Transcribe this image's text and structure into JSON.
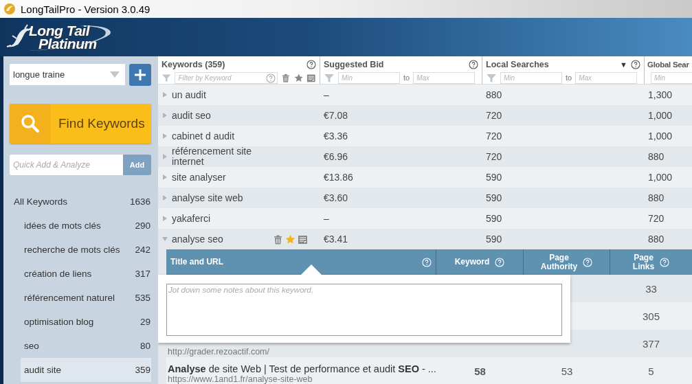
{
  "window": {
    "title": "LongTailPro - Version 3.0.49"
  },
  "logo": {
    "line_1": "Long Tail",
    "line_2": "Platinum"
  },
  "sidebar": {
    "project_select": {
      "value": "longue traine"
    },
    "find_button": "Find Keywords",
    "quick_add": {
      "placeholder": "Quick Add & Analyze",
      "button": "Add"
    },
    "campaigns": [
      {
        "label": "All Keywords",
        "count": "1636",
        "selected": false,
        "children": [
          {
            "label": "idées de mots clés",
            "count": "290",
            "selected": false
          },
          {
            "label": "recherche de mots clés",
            "count": "242",
            "selected": false
          },
          {
            "label": "création de liens",
            "count": "317",
            "selected": false
          },
          {
            "label": "référencement naturel",
            "count": "535",
            "selected": false
          },
          {
            "label": "optimisation blog",
            "count": "29",
            "selected": false
          },
          {
            "label": "seo",
            "count": "80",
            "selected": false
          },
          {
            "label": "audit site",
            "count": "359",
            "selected": true
          }
        ]
      }
    ]
  },
  "table": {
    "columns": [
      {
        "kind": "keyword",
        "title": "Keywords (359)",
        "filter_placeholder": "Filter by Keyword"
      },
      {
        "kind": "range",
        "title": "Suggested Bid",
        "min_placeholder": "Min",
        "to": "to",
        "max_placeholder": "Max"
      },
      {
        "kind": "range",
        "title": "Local Searches",
        "sort_indicator": "▼",
        "min_placeholder": "Min",
        "to": "to",
        "max_placeholder": "Max"
      },
      {
        "kind": "cut",
        "title": "Global Sear",
        "min_placeholder": "Min"
      }
    ],
    "rows": [
      {
        "keyword": "un audit",
        "bid": "–",
        "local": "880",
        "global": "1,300",
        "expanded": false
      },
      {
        "keyword": "audit seo",
        "bid": "€7.08",
        "local": "720",
        "global": "1,000",
        "expanded": false
      },
      {
        "keyword": "cabinet d audit",
        "bid": "€3.36",
        "local": "720",
        "global": "1,000",
        "expanded": false
      },
      {
        "keyword": "référencement site internet",
        "bid": "€6.96",
        "local": "720",
        "global": "880",
        "expanded": false
      },
      {
        "keyword": "site analyser",
        "bid": "€13.86",
        "local": "590",
        "global": "1,000",
        "expanded": false
      },
      {
        "keyword": "analyse site web",
        "bid": "€3.60",
        "local": "590",
        "global": "880",
        "expanded": false
      },
      {
        "keyword": "yakaferci",
        "bid": "–",
        "local": "590",
        "global": "720",
        "expanded": false
      },
      {
        "keyword": "analyse seo",
        "bid": "€3.41",
        "local": "590",
        "global": "880",
        "expanded": true,
        "starred": true
      }
    ]
  },
  "details": {
    "columns": [
      {
        "kind": "title",
        "label": "Title and URL"
      },
      {
        "kind": "number",
        "label": "Keyword"
      },
      {
        "kind": "number",
        "label": "Page Authority"
      },
      {
        "kind": "number",
        "label": "Page Links"
      }
    ],
    "rows": [
      {
        "links": "33"
      },
      {
        "links": "305"
      },
      {
        "url": "http://grader.rezoactif.com/",
        "links": "377"
      },
      {
        "title": "**Analyse** de site Web | Test de performance et audit **SEO** - ...",
        "url": "https://www.1and1.fr/analyse-site-web",
        "competitiveness": "58",
        "authority": "53",
        "links": "5"
      }
    ]
  },
  "notes": {
    "placeholder": "Jot down some notes about this keyword."
  }
}
